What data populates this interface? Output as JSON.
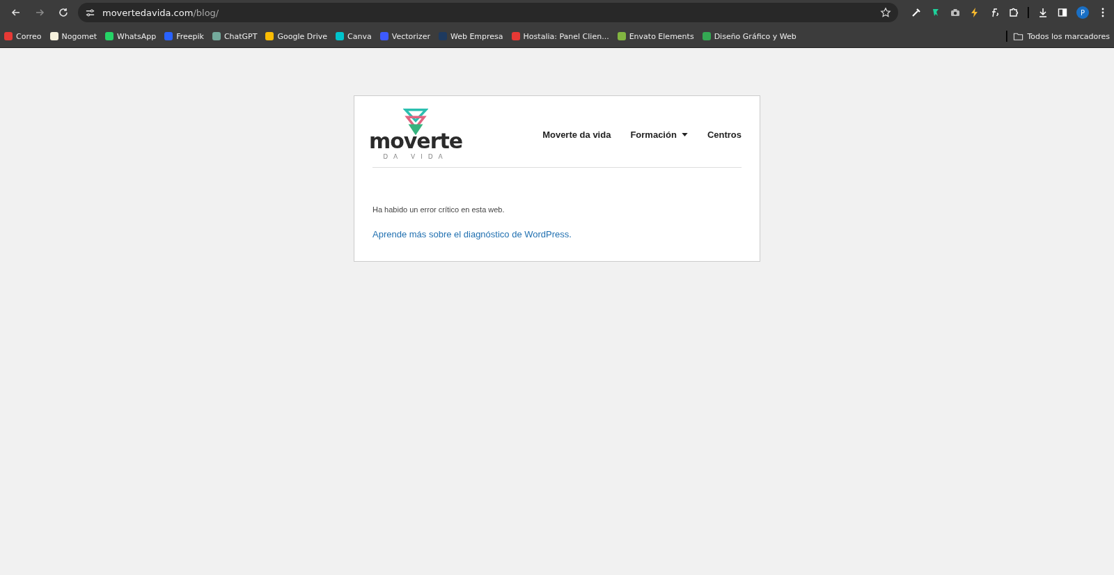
{
  "browser": {
    "url_host": "movertedavida.com",
    "url_path": "/blog/",
    "bookmarks": [
      {
        "label": "Correo"
      },
      {
        "label": "Nogomet"
      },
      {
        "label": "WhatsApp"
      },
      {
        "label": "Freepik"
      },
      {
        "label": "ChatGPT"
      },
      {
        "label": "Google Drive"
      },
      {
        "label": "Canva"
      },
      {
        "label": "Vectorizer"
      },
      {
        "label": "Web Empresa"
      },
      {
        "label": "Hostalia: Panel Clien..."
      },
      {
        "label": "Envato Elements"
      },
      {
        "label": "Diseño Gráfico y Web"
      }
    ],
    "all_bookmarks": "Todos los marcadores",
    "profile_initial": "P"
  },
  "site": {
    "logo_word": "moverte",
    "logo_tagline": "DA VIDA",
    "nav": [
      {
        "label": "Moverte da vida",
        "dropdown": false
      },
      {
        "label": "Formación",
        "dropdown": true
      },
      {
        "label": "Centros",
        "dropdown": false
      }
    ],
    "error_message": "Ha habido un error crítico en esta web.",
    "help_link": "Aprende más sobre el diagnóstico de WordPress."
  }
}
